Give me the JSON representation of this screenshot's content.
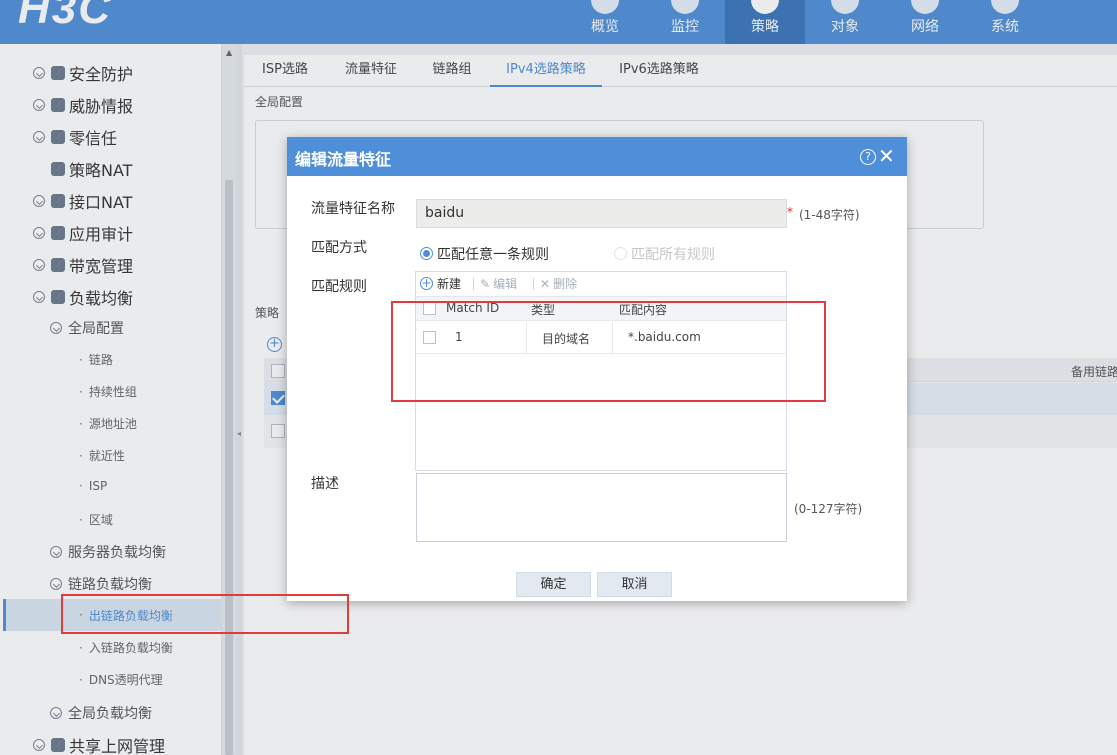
{
  "app": {
    "logo": "H3C"
  },
  "topnav": {
    "items": [
      {
        "label": "概览",
        "active": false
      },
      {
        "label": "监控",
        "active": false
      },
      {
        "label": "策略",
        "active": true
      },
      {
        "label": "对象",
        "active": false
      },
      {
        "label": "网络",
        "active": false
      },
      {
        "label": "系统",
        "active": false
      }
    ]
  },
  "sidebar": {
    "items": [
      {
        "label": "安全防护",
        "level": 1
      },
      {
        "label": "威胁情报",
        "level": 1
      },
      {
        "label": "零信任",
        "level": 1
      },
      {
        "label": "策略NAT",
        "level": 1
      },
      {
        "label": "接口NAT",
        "level": 1
      },
      {
        "label": "应用审计",
        "level": 1
      },
      {
        "label": "带宽管理",
        "level": 1
      },
      {
        "label": "负载均衡",
        "level": 1
      },
      {
        "label": "全局配置",
        "level": 2
      },
      {
        "label": "链路",
        "level": 3
      },
      {
        "label": "持续性组",
        "level": 3
      },
      {
        "label": "源地址池",
        "level": 3
      },
      {
        "label": "就近性",
        "level": 3
      },
      {
        "label": "ISP",
        "level": 3
      },
      {
        "label": "区域",
        "level": 3
      },
      {
        "label": "服务器负载均衡",
        "level": 2
      },
      {
        "label": "链路负载均衡",
        "level": 2
      },
      {
        "label": "出链路负载均衡",
        "level": 3,
        "active": true
      },
      {
        "label": "入链路负载均衡",
        "level": 3
      },
      {
        "label": "DNS透明代理",
        "level": 3
      },
      {
        "label": "全局负载均衡",
        "level": 2
      },
      {
        "label": "共享上网管理",
        "level": 1
      }
    ]
  },
  "tabs": [
    {
      "label": "ISP选路",
      "active": false
    },
    {
      "label": "流量特征",
      "active": false
    },
    {
      "label": "链路组",
      "active": false
    },
    {
      "label": "IPv4选路策略",
      "active": true
    },
    {
      "label": "IPv6选路策略",
      "active": false
    }
  ],
  "main": {
    "global_config_label": "全局配置",
    "policy_label": "策略",
    "backup_link_col": "备用链路"
  },
  "dialog": {
    "title": "编辑流量特征",
    "name_label": "流量特征名称",
    "name_value": "baidu",
    "name_required": "*",
    "name_hint": "(1-48字符)",
    "match_mode_label": "匹配方式",
    "match_any": "匹配任意一条规则",
    "match_all": "匹配所有规则",
    "rules_label": "匹配规则",
    "toolbar": {
      "new": "新建",
      "edit": "编辑",
      "delete": "删除"
    },
    "columns": [
      "Match ID",
      "类型",
      "匹配内容"
    ],
    "rows": [
      {
        "id": "1",
        "type": "目的域名",
        "content": "*.baidu.com"
      }
    ],
    "desc_label": "描述",
    "desc_hint": "(0-127字符)",
    "ok": "确定",
    "cancel": "取消"
  },
  "colors": {
    "primary": "#4f8fda",
    "highlight": "#e23b3b"
  }
}
